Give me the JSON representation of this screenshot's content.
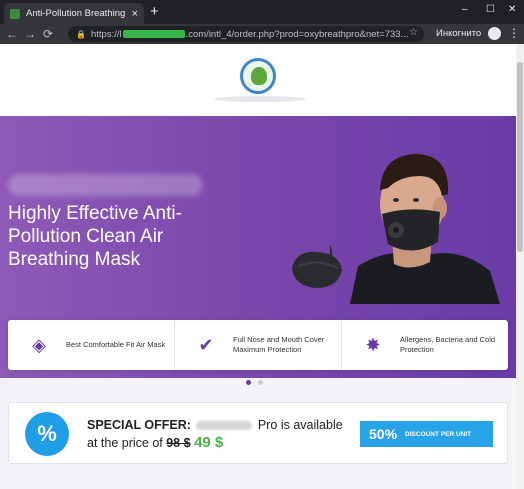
{
  "browser": {
    "tab_title": "Anti-Pollution Breathing M",
    "tab_close": "×",
    "new_tab": "+",
    "window_controls": {
      "minimize": "–",
      "maximize": "☐",
      "close": "✕"
    },
    "nav": {
      "back": "←",
      "forward": "→",
      "reload": "⟳"
    },
    "url_prefix": "https://l",
    "url_suffix": ".com/intl_4/order.php?prod=oxybreathpro&net=733...",
    "incognito_label": "Инкогнито",
    "menu": "⋮"
  },
  "hero": {
    "headline": "Highly Effective Anti-Pollution Clean Air Breathing Mask"
  },
  "features": [
    {
      "icon": "mask-icon",
      "text": "Best Comfortable Fit Air Mask"
    },
    {
      "icon": "check-icon",
      "text": "Full Nose and Mouth Cover Maximum Protection"
    },
    {
      "icon": "virus-icon",
      "text": "Allergens, Bacteria and Cold Protection"
    }
  ],
  "offer": {
    "badge": "%",
    "label": "SPECIAL OFFER:",
    "product_suffix": "Pro is available",
    "price_prefix": "at the price of",
    "old_price": "98 $",
    "new_price": "49 $",
    "discount_percent": "50%",
    "discount_text": "DISCOUNT PER UNIT"
  },
  "colors": {
    "brand_purple": "#6a3aa6",
    "discount_blue": "#29a3e8",
    "price_green": "#49b04a"
  }
}
